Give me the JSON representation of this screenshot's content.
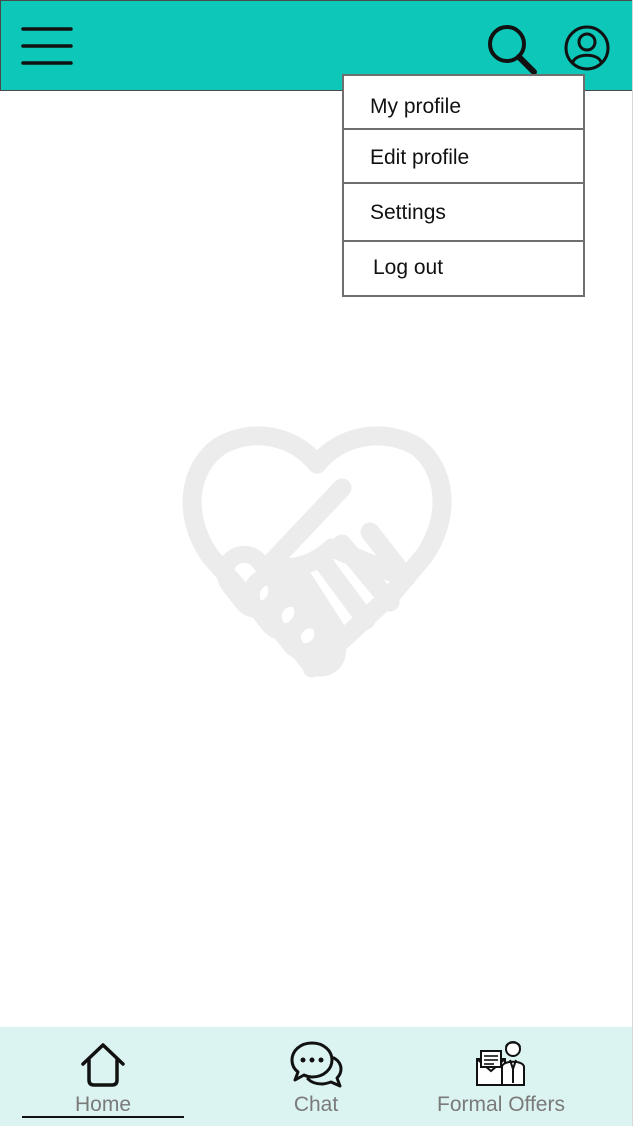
{
  "colors": {
    "topbar_bg": "#0dc7b8",
    "bottomnav_bg": "#dcf4f1",
    "logo_tint": "#ececec",
    "icon_color": "#111111"
  },
  "topbar": {
    "menu_icon": "hamburger-menu-icon",
    "search_icon": "search-icon",
    "account_icon": "account-circle-icon"
  },
  "account_menu": {
    "items": [
      {
        "label": "My profile"
      },
      {
        "label": "Edit profile"
      },
      {
        "label": "Settings"
      },
      {
        "label": "Log out"
      }
    ]
  },
  "logo": {
    "icon": "heart-handshake-logo"
  },
  "bottom_nav": {
    "active": "Home",
    "items": [
      {
        "label": "Home",
        "icon": "home-icon"
      },
      {
        "label": "Chat",
        "icon": "chat-bubbles-icon"
      },
      {
        "label": "Formal Offers",
        "icon": "formal-offers-icon"
      }
    ]
  }
}
